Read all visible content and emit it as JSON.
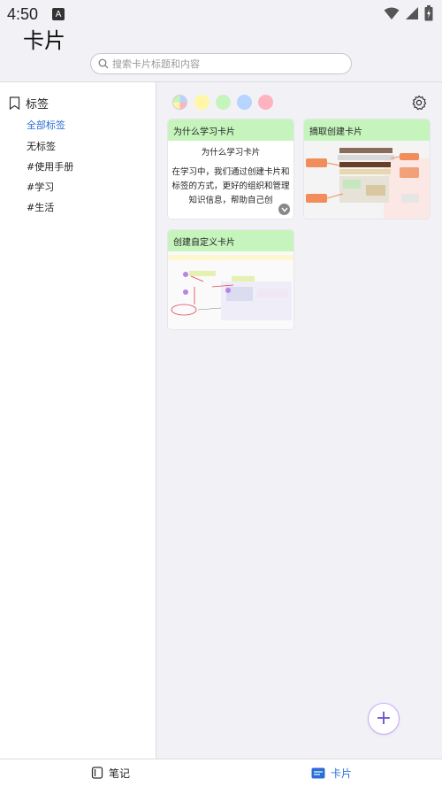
{
  "status_bar": {
    "time": "4:50",
    "app_icon_letter": "A"
  },
  "header": {
    "title": "卡片"
  },
  "search": {
    "placeholder": "搜索卡片标题和内容"
  },
  "sidebar": {
    "header": "标签",
    "items": [
      {
        "label": "全部标签",
        "active": true
      },
      {
        "label": "无标签",
        "active": false
      },
      {
        "label": "#使用手册",
        "active": false
      },
      {
        "label": "#学习",
        "active": false
      },
      {
        "label": "#生活",
        "active": false
      }
    ]
  },
  "color_filters": [
    "multicolor",
    "#fff6a8",
    "#c6f4bd",
    "#b6d4ff",
    "#ffb3c1"
  ],
  "cards": [
    {
      "title": "为什么学习卡片",
      "subtitle": "为什么学习卡片",
      "text": "在学习中，我们通过创建卡片和标签的方式，更好的组织和管理知识信息，帮助自己创"
    },
    {
      "title": "摘取创建卡片"
    },
    {
      "title": "创建自定义卡片"
    }
  ],
  "bottom_nav": {
    "notes_label": "笔记",
    "cards_label": "卡片"
  },
  "colors": {
    "accent": "#2a6fd6",
    "card_header": "#c6f4bd",
    "fab_border": "#c9a7ff"
  }
}
